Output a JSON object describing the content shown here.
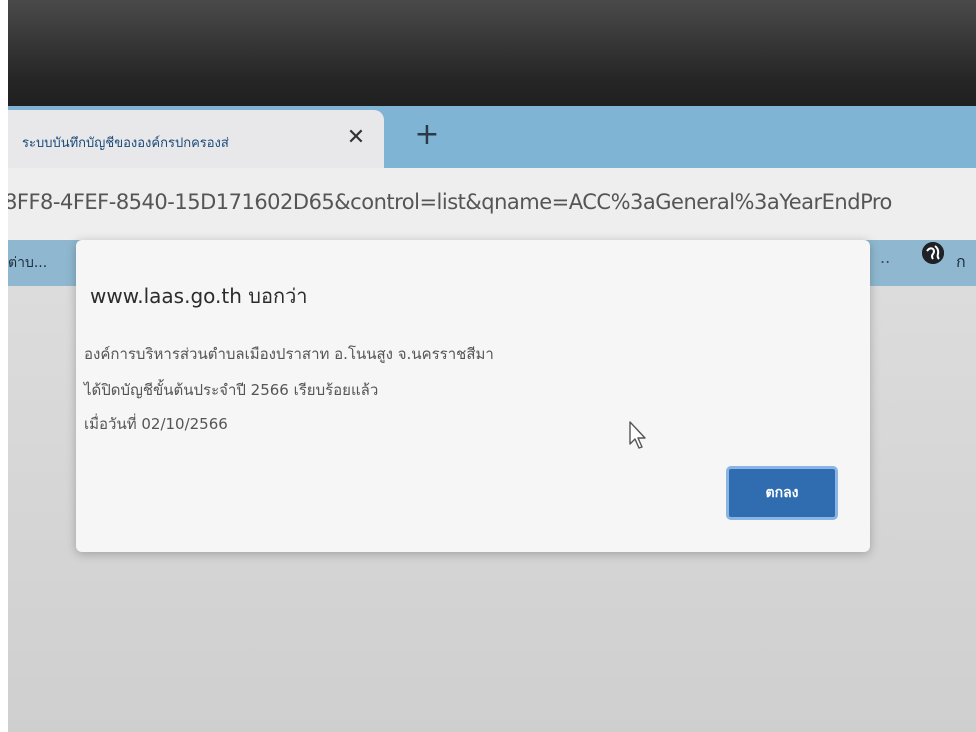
{
  "browser": {
    "tab": {
      "title": "ระบบบันทึกบัญชีขององค์กรปกครองส่",
      "close_glyph": "✕"
    },
    "new_tab_glyph": "+",
    "address_bar": {
      "url_visible": "8FF8-4FEF-8540-15D171602D65&control=list&qname=ACC%3aGeneral%3aYearEndPro"
    },
    "bookmarks": {
      "left_item": "ต่าบ...",
      "ellipsis": "..",
      "right_item": "ก"
    }
  },
  "dialog": {
    "origin": "www.laas.go.th บอกว่า",
    "message_lines": [
      "องค์การบริหารส่วนตำบลเมืองปราสาท อ.โนนสูง จ.นครราชสีมา",
      "ได้ปิดบัญชีขั้นต้นประจำปี 2566 เรียบร้อยแล้ว",
      "เมื่อวันที่ 02/10/2566"
    ],
    "ok_label": "ตกลง"
  },
  "icons": {
    "globe": "globe-icon",
    "cursor": "mouse-pointer-icon"
  },
  "colors": {
    "tabstrip": "#7fb4d4",
    "ok_button": "#2f6db0",
    "bezel": "#262626"
  }
}
